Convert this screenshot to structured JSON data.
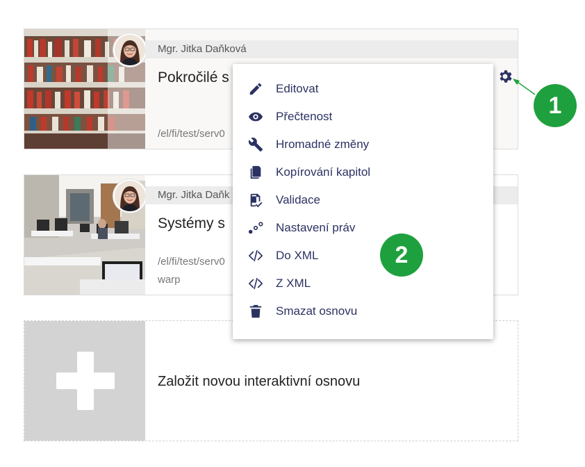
{
  "cards": [
    {
      "author": "Mgr. Jitka Daňková",
      "title": "Pokročilé s",
      "path": "/el/fi/test/serv0"
    },
    {
      "author": "Mgr. Jitka Daňk",
      "title": "Systémy s",
      "path": "/el/fi/test/serv0",
      "path2": "warp"
    }
  ],
  "add_card": {
    "label": "Založit novou interaktivní osnovu"
  },
  "menu": {
    "items": [
      {
        "label": "Editovat",
        "icon": "pencil-icon"
      },
      {
        "label": "Přečtenost",
        "icon": "eye-icon"
      },
      {
        "label": "Hromadné změny",
        "icon": "wrench-icon"
      },
      {
        "label": "Kopírování kapitol",
        "icon": "copy-icon"
      },
      {
        "label": "Validace",
        "icon": "validate-icon"
      },
      {
        "label": "Nastavení práv",
        "icon": "share-nodes-icon"
      },
      {
        "label": "Do XML",
        "icon": "code-icon"
      },
      {
        "label": "Z XML",
        "icon": "code-icon"
      },
      {
        "label": "Smazat osnovu",
        "icon": "trash-icon"
      }
    ]
  },
  "callouts": [
    {
      "number": "1"
    },
    {
      "number": "2"
    }
  ],
  "colors": {
    "menu_text": "#2b3262",
    "callout": "#1fa03e",
    "add_box": "#d3d3d3"
  }
}
